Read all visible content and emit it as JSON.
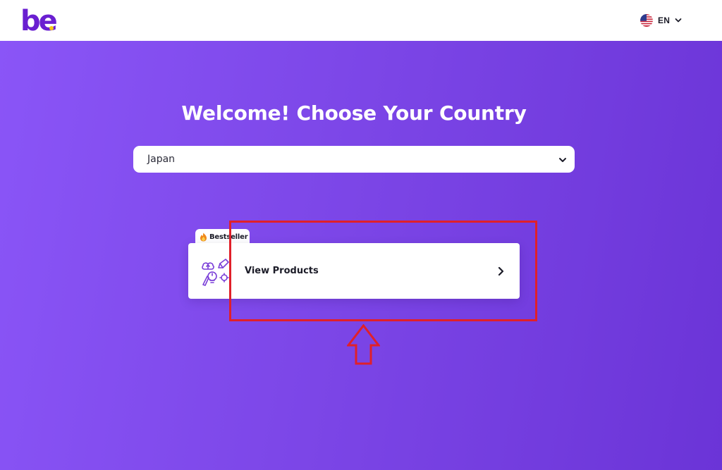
{
  "header": {
    "logo_text": "be",
    "language": {
      "code": "EN",
      "flag_icon": "us-flag-icon",
      "dropdown_icon": "chevron-down-icon"
    }
  },
  "main": {
    "title": "Welcome! Choose Your Country",
    "country_select": {
      "value": "Japan",
      "dropdown_icon": "chevron-down-icon"
    },
    "product_card": {
      "badge": "Bestseller",
      "badge_icon": "flame-icon",
      "icon": "product-illustration-icon",
      "label": "View Products",
      "arrow_icon": "chevron-right-icon"
    }
  },
  "annotation": {
    "highlight_color": "#e0202a",
    "arrow_icon": "up-arrow-icon"
  },
  "colors": {
    "brand": "#6a1fd1",
    "gradient_start": "#8a55f7",
    "gradient_end": "#6b34d7",
    "logo_dot": "#f5c518"
  }
}
